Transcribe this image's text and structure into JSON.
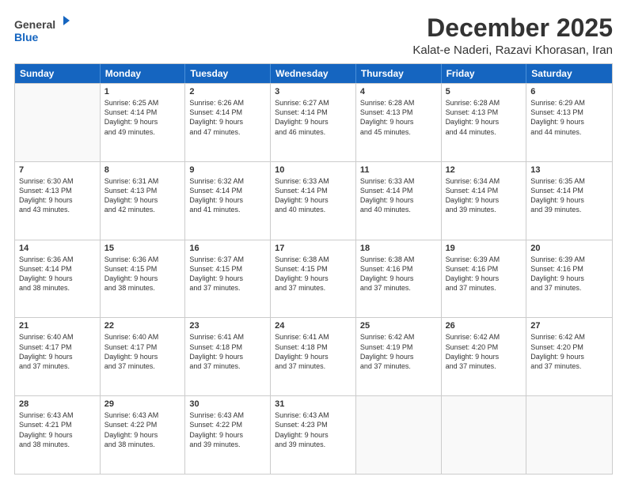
{
  "logo": {
    "general": "General",
    "blue": "Blue"
  },
  "header": {
    "month": "December 2025",
    "location": "Kalat-e Naderi, Razavi Khorasan, Iran"
  },
  "weekdays": [
    "Sunday",
    "Monday",
    "Tuesday",
    "Wednesday",
    "Thursday",
    "Friday",
    "Saturday"
  ],
  "weeks": [
    [
      {
        "day": "",
        "sunrise": "",
        "sunset": "",
        "daylight": ""
      },
      {
        "day": "1",
        "sunrise": "Sunrise: 6:25 AM",
        "sunset": "Sunset: 4:14 PM",
        "daylight": "Daylight: 9 hours",
        "daylight2": "and 49 minutes."
      },
      {
        "day": "2",
        "sunrise": "Sunrise: 6:26 AM",
        "sunset": "Sunset: 4:14 PM",
        "daylight": "Daylight: 9 hours",
        "daylight2": "and 47 minutes."
      },
      {
        "day": "3",
        "sunrise": "Sunrise: 6:27 AM",
        "sunset": "Sunset: 4:14 PM",
        "daylight": "Daylight: 9 hours",
        "daylight2": "and 46 minutes."
      },
      {
        "day": "4",
        "sunrise": "Sunrise: 6:28 AM",
        "sunset": "Sunset: 4:13 PM",
        "daylight": "Daylight: 9 hours",
        "daylight2": "and 45 minutes."
      },
      {
        "day": "5",
        "sunrise": "Sunrise: 6:28 AM",
        "sunset": "Sunset: 4:13 PM",
        "daylight": "Daylight: 9 hours",
        "daylight2": "and 44 minutes."
      },
      {
        "day": "6",
        "sunrise": "Sunrise: 6:29 AM",
        "sunset": "Sunset: 4:13 PM",
        "daylight": "Daylight: 9 hours",
        "daylight2": "and 44 minutes."
      }
    ],
    [
      {
        "day": "7",
        "sunrise": "Sunrise: 6:30 AM",
        "sunset": "Sunset: 4:13 PM",
        "daylight": "Daylight: 9 hours",
        "daylight2": "and 43 minutes."
      },
      {
        "day": "8",
        "sunrise": "Sunrise: 6:31 AM",
        "sunset": "Sunset: 4:13 PM",
        "daylight": "Daylight: 9 hours",
        "daylight2": "and 42 minutes."
      },
      {
        "day": "9",
        "sunrise": "Sunrise: 6:32 AM",
        "sunset": "Sunset: 4:14 PM",
        "daylight": "Daylight: 9 hours",
        "daylight2": "and 41 minutes."
      },
      {
        "day": "10",
        "sunrise": "Sunrise: 6:33 AM",
        "sunset": "Sunset: 4:14 PM",
        "daylight": "Daylight: 9 hours",
        "daylight2": "and 40 minutes."
      },
      {
        "day": "11",
        "sunrise": "Sunrise: 6:33 AM",
        "sunset": "Sunset: 4:14 PM",
        "daylight": "Daylight: 9 hours",
        "daylight2": "and 40 minutes."
      },
      {
        "day": "12",
        "sunrise": "Sunrise: 6:34 AM",
        "sunset": "Sunset: 4:14 PM",
        "daylight": "Daylight: 9 hours",
        "daylight2": "and 39 minutes."
      },
      {
        "day": "13",
        "sunrise": "Sunrise: 6:35 AM",
        "sunset": "Sunset: 4:14 PM",
        "daylight": "Daylight: 9 hours",
        "daylight2": "and 39 minutes."
      }
    ],
    [
      {
        "day": "14",
        "sunrise": "Sunrise: 6:36 AM",
        "sunset": "Sunset: 4:14 PM",
        "daylight": "Daylight: 9 hours",
        "daylight2": "and 38 minutes."
      },
      {
        "day": "15",
        "sunrise": "Sunrise: 6:36 AM",
        "sunset": "Sunset: 4:15 PM",
        "daylight": "Daylight: 9 hours",
        "daylight2": "and 38 minutes."
      },
      {
        "day": "16",
        "sunrise": "Sunrise: 6:37 AM",
        "sunset": "Sunset: 4:15 PM",
        "daylight": "Daylight: 9 hours",
        "daylight2": "and 37 minutes."
      },
      {
        "day": "17",
        "sunrise": "Sunrise: 6:38 AM",
        "sunset": "Sunset: 4:15 PM",
        "daylight": "Daylight: 9 hours",
        "daylight2": "and 37 minutes."
      },
      {
        "day": "18",
        "sunrise": "Sunrise: 6:38 AM",
        "sunset": "Sunset: 4:16 PM",
        "daylight": "Daylight: 9 hours",
        "daylight2": "and 37 minutes."
      },
      {
        "day": "19",
        "sunrise": "Sunrise: 6:39 AM",
        "sunset": "Sunset: 4:16 PM",
        "daylight": "Daylight: 9 hours",
        "daylight2": "and 37 minutes."
      },
      {
        "day": "20",
        "sunrise": "Sunrise: 6:39 AM",
        "sunset": "Sunset: 4:16 PM",
        "daylight": "Daylight: 9 hours",
        "daylight2": "and 37 minutes."
      }
    ],
    [
      {
        "day": "21",
        "sunrise": "Sunrise: 6:40 AM",
        "sunset": "Sunset: 4:17 PM",
        "daylight": "Daylight: 9 hours",
        "daylight2": "and 37 minutes."
      },
      {
        "day": "22",
        "sunrise": "Sunrise: 6:40 AM",
        "sunset": "Sunset: 4:17 PM",
        "daylight": "Daylight: 9 hours",
        "daylight2": "and 37 minutes."
      },
      {
        "day": "23",
        "sunrise": "Sunrise: 6:41 AM",
        "sunset": "Sunset: 4:18 PM",
        "daylight": "Daylight: 9 hours",
        "daylight2": "and 37 minutes."
      },
      {
        "day": "24",
        "sunrise": "Sunrise: 6:41 AM",
        "sunset": "Sunset: 4:18 PM",
        "daylight": "Daylight: 9 hours",
        "daylight2": "and 37 minutes."
      },
      {
        "day": "25",
        "sunrise": "Sunrise: 6:42 AM",
        "sunset": "Sunset: 4:19 PM",
        "daylight": "Daylight: 9 hours",
        "daylight2": "and 37 minutes."
      },
      {
        "day": "26",
        "sunrise": "Sunrise: 6:42 AM",
        "sunset": "Sunset: 4:20 PM",
        "daylight": "Daylight: 9 hours",
        "daylight2": "and 37 minutes."
      },
      {
        "day": "27",
        "sunrise": "Sunrise: 6:42 AM",
        "sunset": "Sunset: 4:20 PM",
        "daylight": "Daylight: 9 hours",
        "daylight2": "and 37 minutes."
      }
    ],
    [
      {
        "day": "28",
        "sunrise": "Sunrise: 6:43 AM",
        "sunset": "Sunset: 4:21 PM",
        "daylight": "Daylight: 9 hours",
        "daylight2": "and 38 minutes."
      },
      {
        "day": "29",
        "sunrise": "Sunrise: 6:43 AM",
        "sunset": "Sunset: 4:22 PM",
        "daylight": "Daylight: 9 hours",
        "daylight2": "and 38 minutes."
      },
      {
        "day": "30",
        "sunrise": "Sunrise: 6:43 AM",
        "sunset": "Sunset: 4:22 PM",
        "daylight": "Daylight: 9 hours",
        "daylight2": "and 39 minutes."
      },
      {
        "day": "31",
        "sunrise": "Sunrise: 6:43 AM",
        "sunset": "Sunset: 4:23 PM",
        "daylight": "Daylight: 9 hours",
        "daylight2": "and 39 minutes."
      },
      {
        "day": "",
        "sunrise": "",
        "sunset": "",
        "daylight": "",
        "daylight2": ""
      },
      {
        "day": "",
        "sunrise": "",
        "sunset": "",
        "daylight": "",
        "daylight2": ""
      },
      {
        "day": "",
        "sunrise": "",
        "sunset": "",
        "daylight": "",
        "daylight2": ""
      }
    ]
  ]
}
